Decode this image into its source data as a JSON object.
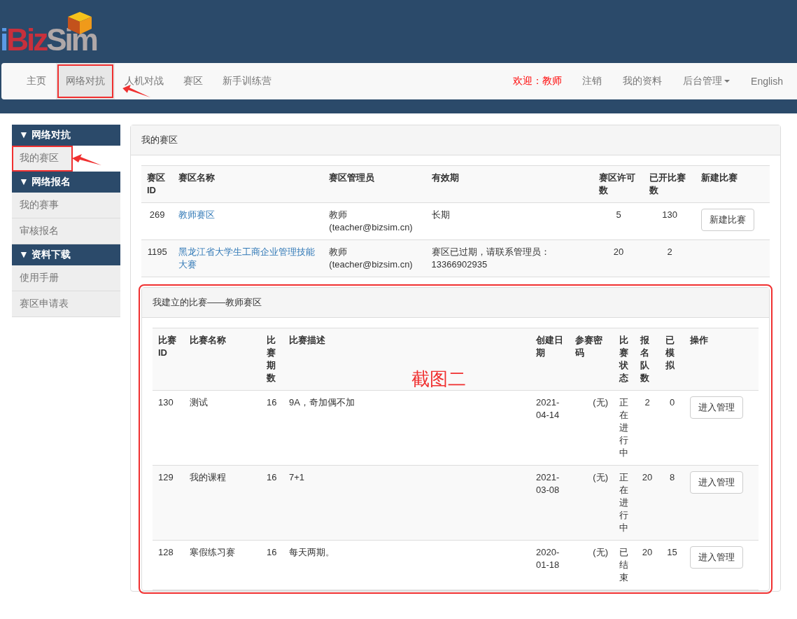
{
  "logo": {
    "parts": [
      "i",
      "Biz",
      "Sim"
    ]
  },
  "nav": {
    "left": [
      {
        "label": "主页",
        "selected": false,
        "annotated": false
      },
      {
        "label": "网络对抗",
        "selected": true,
        "annotated": true
      },
      {
        "label": "人机对战",
        "selected": false,
        "annotated": false
      },
      {
        "label": "赛区",
        "selected": false,
        "annotated": false
      },
      {
        "label": "新手训练营",
        "selected": false,
        "annotated": false
      }
    ],
    "welcome": "欢迎：教师",
    "right": [
      {
        "label": "注销",
        "dropdown": false
      },
      {
        "label": "我的资料",
        "dropdown": false
      },
      {
        "label": "后台管理",
        "dropdown": true
      },
      {
        "label": "English",
        "dropdown": false
      }
    ]
  },
  "sidebar": [
    {
      "title": "▼ 网络对抗",
      "items": [
        {
          "label": "我的赛区",
          "annotated": true
        }
      ]
    },
    {
      "title": "▼ 网络报名",
      "items": [
        {
          "label": "我的赛事",
          "annotated": false
        },
        {
          "label": "审核报名",
          "annotated": false
        }
      ]
    },
    {
      "title": "▼ 资料下载",
      "items": [
        {
          "label": "使用手册",
          "annotated": false
        },
        {
          "label": "赛区申请表",
          "annotated": false
        }
      ]
    }
  ],
  "zones_panel": {
    "title": "我的赛区",
    "columns": [
      "赛区ID",
      "赛区名称",
      "赛区管理员",
      "有效期",
      "赛区许可数",
      "已开比赛数",
      "新建比赛"
    ],
    "rows": [
      {
        "id": "269",
        "name": "教师赛区",
        "admin": "教师 (teacher@bizsim.cn)",
        "validity": "长期",
        "licenses": "5",
        "opened": "130",
        "button": "新建比赛"
      },
      {
        "id": "1195",
        "name": "黑龙江省大学生工商企业管理技能大赛",
        "admin": "教师 (teacher@bizsim.cn)",
        "validity": "赛区已过期，请联系管理员：13366902935",
        "licenses": "20",
        "opened": "2"
      }
    ]
  },
  "games_panel": {
    "title": "我建立的比赛——教师赛区",
    "annotated": true,
    "columns": [
      "比赛ID",
      "比赛名称",
      "比赛期数",
      "比赛描述",
      "创建日期",
      "参赛密码",
      "比赛状态",
      "报名队数",
      "已模拟",
      "操作"
    ],
    "rows": [
      {
        "id": "130",
        "name": "测试",
        "periods": "16",
        "description": "9A，奇加偶不加",
        "date": "2021-04-14",
        "password": "(无)",
        "status": "正在进行中",
        "teams": "2",
        "simulated": "0",
        "button": "进入管理"
      },
      {
        "id": "129",
        "name": "我的课程",
        "periods": "16",
        "description": "7+1",
        "date": "2021-03-08",
        "password": "(无)",
        "status": "正在进行中",
        "teams": "20",
        "simulated": "8",
        "button": "进入管理"
      },
      {
        "id": "128",
        "name": "寒假练习赛",
        "periods": "16",
        "description": "每天两期。",
        "date": "2020-01-18",
        "password": "(无)",
        "status": "已结束",
        "teams": "20",
        "simulated": "15",
        "button": "进入管理"
      }
    ]
  },
  "annotation_label": "截图二"
}
